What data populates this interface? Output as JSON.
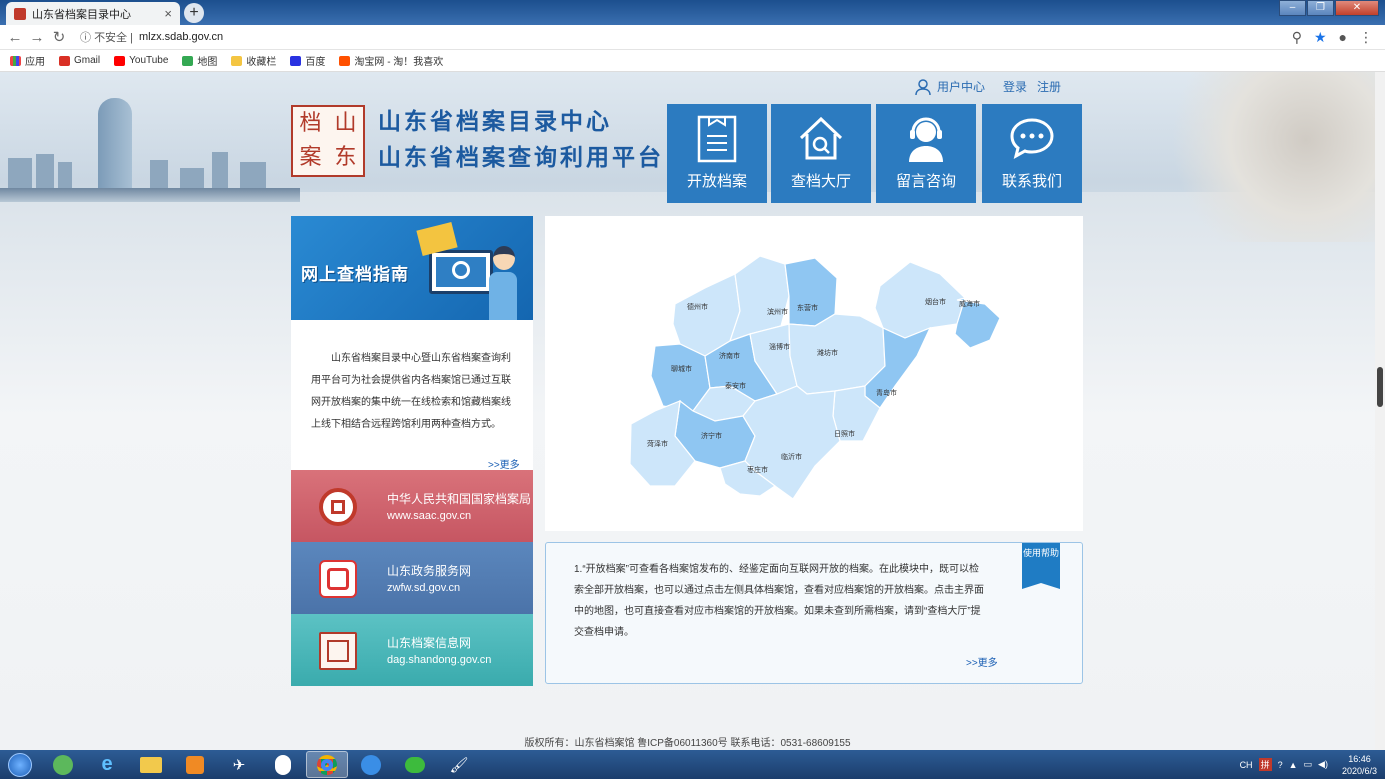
{
  "browser": {
    "tab_title": "山东省档案目录中心",
    "insecure_label": "不安全",
    "url": "mlzx.sdab.gov.cn",
    "bookmarks": [
      "应用",
      "Gmail",
      "YouTube",
      "地图",
      "收藏栏",
      "百度",
      "淘宝网 - 淘！我喜欢"
    ]
  },
  "header": {
    "user_center": "用户中心",
    "login": "登录",
    "register": "注册",
    "logo_text": [
      "档",
      "山",
      "案",
      "东"
    ],
    "title_line1": "山东省档案目录中心",
    "title_line2": "山东省档案查询利用平台",
    "nav": [
      "开放档案",
      "查档大厅",
      "留言咨询",
      "联系我们"
    ]
  },
  "guide": {
    "banner": "网上查档指南",
    "intro": "山东省档案目录中心暨山东省档案查询利用平台可为社会提供省内各档案馆已通过互联网开放档案的集中统一在线检索和馆藏档案线上线下相结合远程跨馆利用两种查档方式。",
    "more": ">>更多"
  },
  "links": [
    {
      "name": "中华人民共和国国家档案局",
      "url": "www.saac.gov.cn"
    },
    {
      "name": "山东政务服务网",
      "url": "zwfw.sd.gov.cn"
    },
    {
      "name": "山东档案信息网",
      "url": "dag.shandong.gov.cn"
    }
  ],
  "map": {
    "cities": [
      "德州市",
      "滨州市",
      "东营市",
      "烟台市",
      "威海市",
      "聊城市",
      "济南市",
      "淄博市",
      "潍坊市",
      "泰安市",
      "青岛市",
      "日照市",
      "济宁市",
      "临沂市",
      "菏泽市",
      "枣庄市"
    ]
  },
  "help": {
    "badge": "使用帮助",
    "text": "1.“开放档案”可查看各档案馆发布的、经鉴定面向互联网开放的档案。在此模块中，既可以检索全部开放档案，也可以通过点击左侧具体档案馆，查看对应档案馆的开放档案。点击主界面中的地图，也可直接查看对应市档案馆的开放档案。如果未查到所需档案，请到“查档大厅”提交查档申请。",
    "more": ">>更多"
  },
  "footer": "版权所有：山东省档案馆 鲁ICP备06011360号 联系电话：0531-68609155",
  "taskbar": {
    "time": "16:46",
    "date": "2020/6/3",
    "ime": "CH"
  },
  "colors": {
    "nav_blue": "#2c7bc0",
    "title_blue": "#1c5aa0",
    "map_dark": "#8fc6f2",
    "map_light": "#cde6fa",
    "card_red": "#c65662",
    "card_blue": "#4b73a9",
    "card_teal": "#3aabad"
  }
}
